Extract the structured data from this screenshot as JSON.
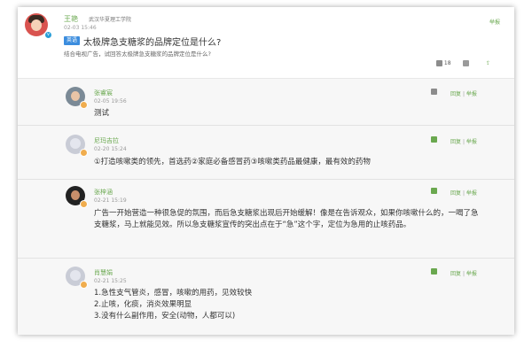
{
  "question": {
    "user": "王艳",
    "school": "武汉华夏理工学院",
    "date": "02-03 15:46",
    "tag": "英语",
    "title": "太极牌急支糖浆的品牌定位是什么?",
    "subtitle": "结合电视广告，试回答太极牌急支糖浆的品牌定位是什么?",
    "report": "举报",
    "likes": "18"
  },
  "comments": [
    {
      "user": "张睿宸",
      "date": "02-05 19:56",
      "text": "测试",
      "reply": "回复",
      "report": "举报",
      "avatar_style": "photo"
    },
    {
      "user": "尼玛吉拉",
      "date": "02-20 15:24",
      "text": "①打造咳嗽类的领先，首选药②家庭必备感冒药③咳嗽类药品最健康，最有效的药物",
      "reply": "回复",
      "report": "举报",
      "avatar_style": "default"
    },
    {
      "user": "张梓涵",
      "date": "02-21 15:19",
      "text": "广告一开始营造一种很急促的氛围，而后急支糖浆出现后开始缓解！像是在告诉观众，如果你咳嗽什么的，一喝了急支糖浆，马上就能见效。所以急支糖浆宣传的突出点在于“急”这个字，定位为急用的止咳药品。",
      "reply": "回复",
      "report": "举报",
      "avatar_style": "dark"
    },
    {
      "user": "肖慧娟",
      "date": "02-21 15:25",
      "text_lines": [
        "1.急性支气管炎，感冒，咳嗽的用药，见效较快",
        "2.止咳，化痰，消炎效果明显",
        "3.没有什么副作用，安全(动物，人都可以)"
      ],
      "reply": "回复",
      "report": "举报",
      "avatar_style": "default"
    }
  ]
}
